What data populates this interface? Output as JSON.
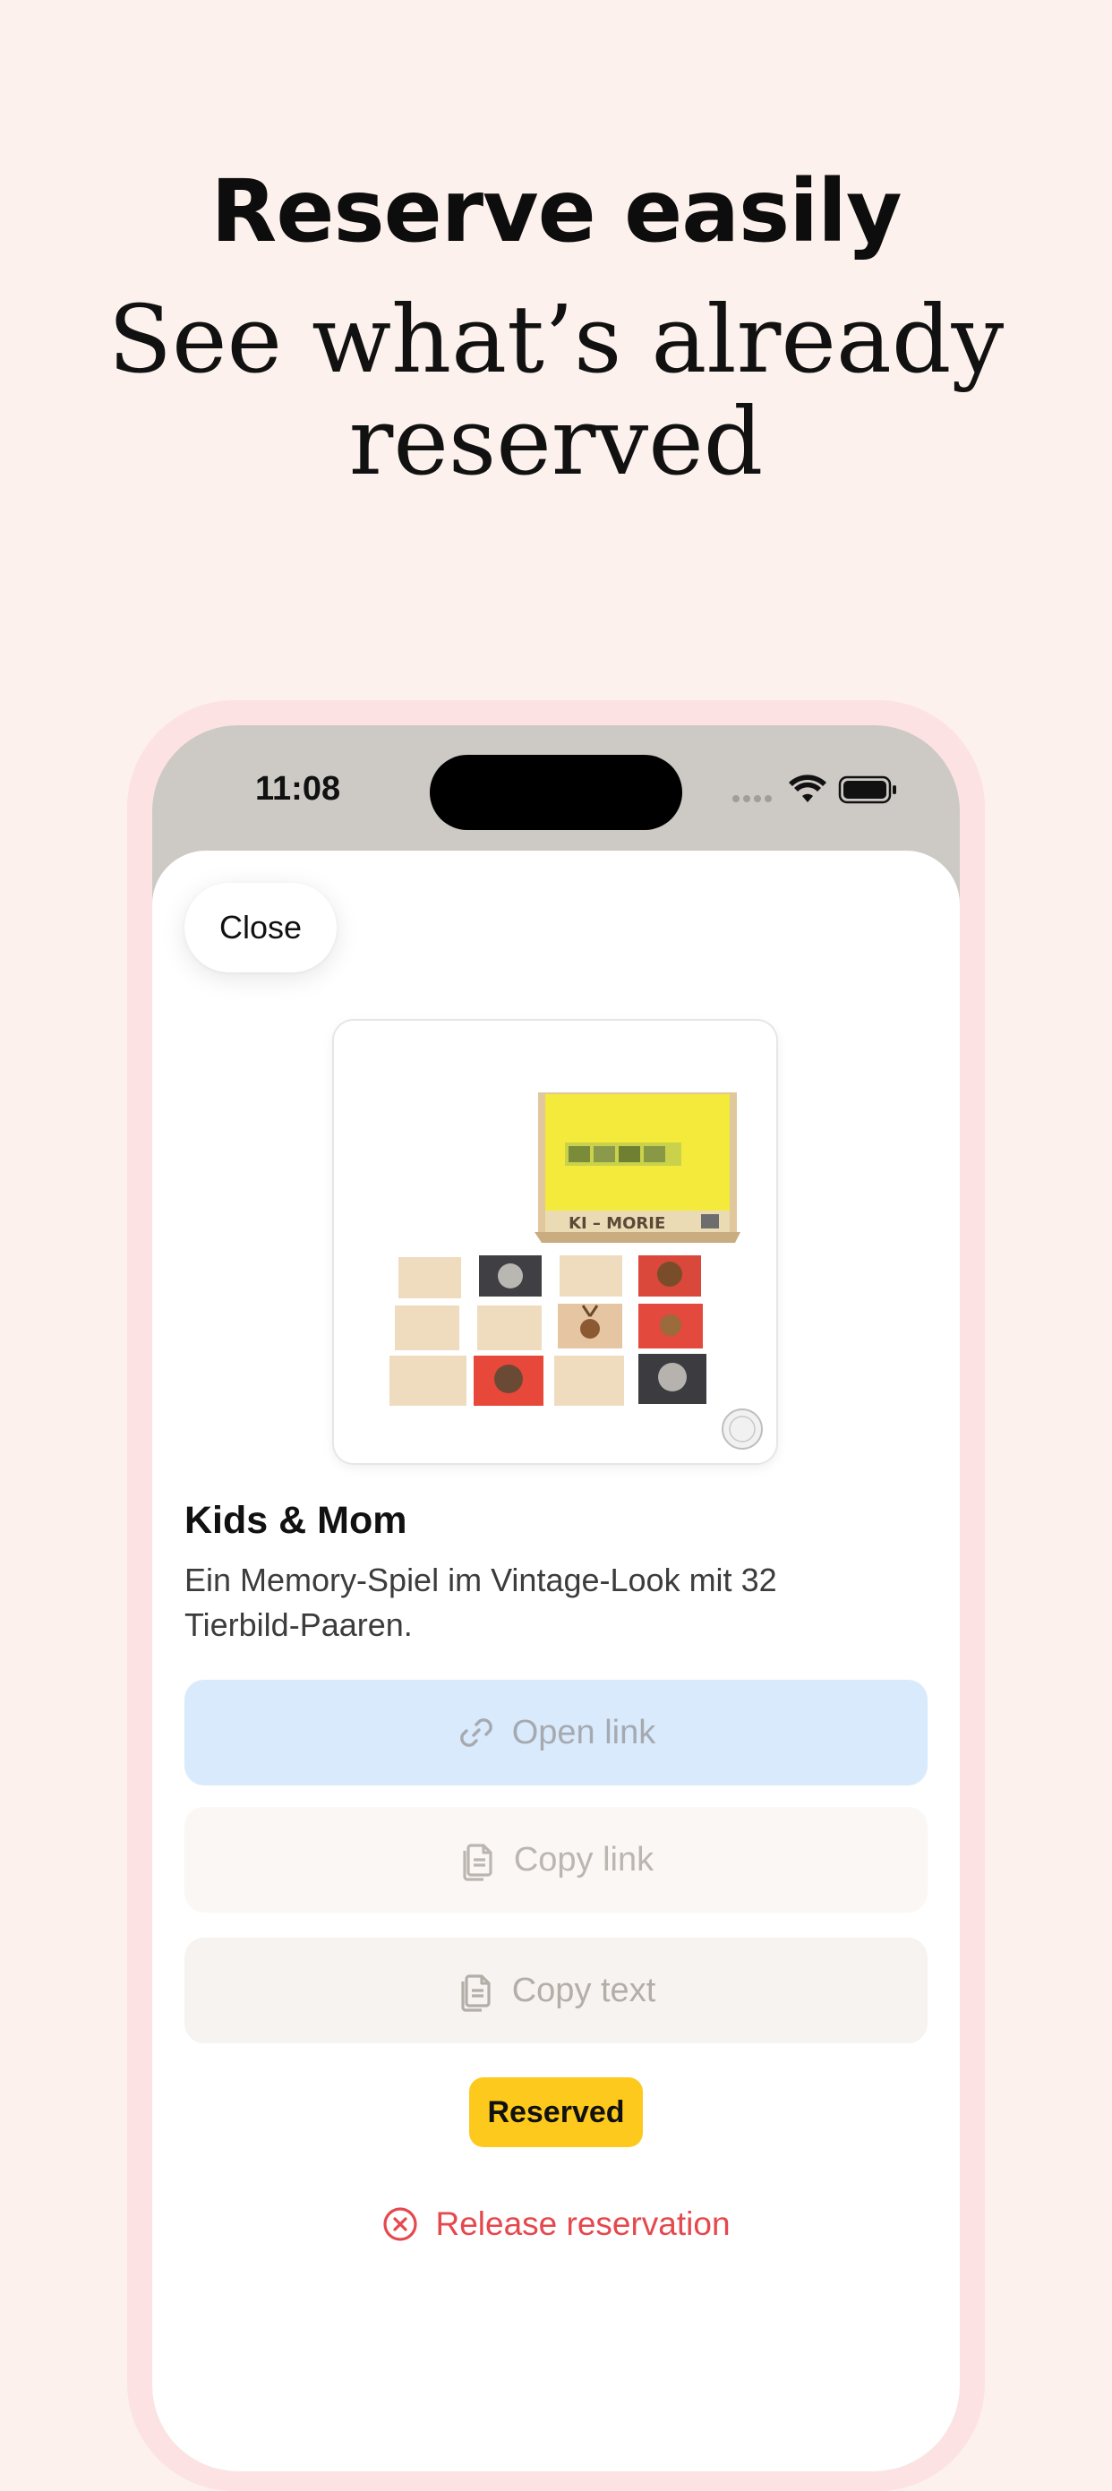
{
  "hero": {
    "title": "Reserve easily",
    "subtitle_line1": "See what’s already",
    "subtitle_line2": "reserved"
  },
  "status_bar": {
    "time": "11:08",
    "icons": [
      "signal-dots-icon",
      "wifi-icon",
      "battery-icon"
    ]
  },
  "sheet": {
    "close_label": "Close",
    "product": {
      "image_icon": "memory-game-product-image",
      "title": "Kids & Mom",
      "description": "Ein Memory-Spiel im Vintage-Look mit 32 Tierbild-Paaren."
    },
    "actions": {
      "open_link": "Open link",
      "copy_link": "Copy link",
      "copy_text": "Copy text"
    },
    "status_badge": "Reserved",
    "release_label": "Release reservation"
  },
  "colors": {
    "background": "#fcf1ec",
    "phone_frame": "#fde2e3",
    "open_link_bg": "#d9eafc",
    "badge": "#fdc91c",
    "destructive": "#e5484d"
  }
}
